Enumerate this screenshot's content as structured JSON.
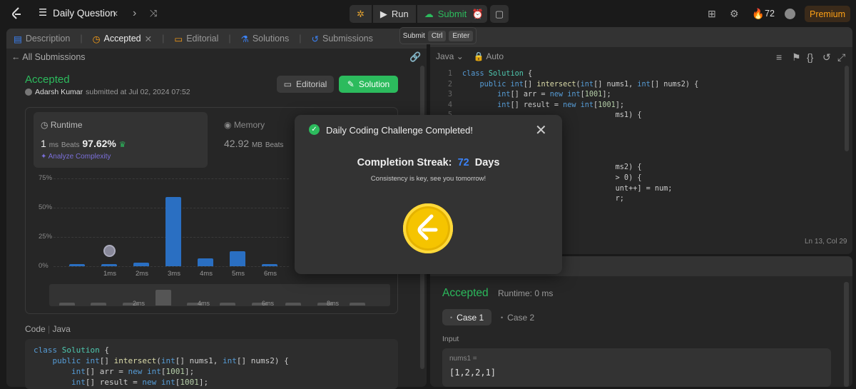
{
  "topbar": {
    "title": "Daily Question",
    "run_label": "Run",
    "submit_label": "Submit",
    "streak_count": "72",
    "premium_label": "Premium"
  },
  "tooltip": {
    "label": "Submit",
    "key1": "Ctrl",
    "key2": "Enter"
  },
  "tabs": [
    {
      "label": "Description"
    },
    {
      "label": "Accepted"
    },
    {
      "label": "Editorial"
    },
    {
      "label": "Solutions"
    },
    {
      "label": "Submissions"
    }
  ],
  "submission": {
    "back_label": "All Submissions",
    "status": "Accepted",
    "author": "Adarsh Kumar",
    "submitted_text": "submitted at Jul 02, 2024 07:52",
    "editorial_label": "Editorial",
    "solution_label": "Solution"
  },
  "runtime": {
    "title": "Runtime",
    "value": "1",
    "unit": "ms",
    "beats_label": "Beats",
    "beats": "97.62%",
    "analyze_label": "Analyze Complexity"
  },
  "memory": {
    "title": "Memory",
    "value": "42.92",
    "unit": "MB",
    "beats_label": "Beats"
  },
  "chart_data": {
    "type": "bar",
    "categories": [
      "0ms",
      "1ms",
      "2ms",
      "3ms",
      "4ms",
      "5ms",
      "6ms"
    ],
    "values": [
      2,
      2,
      3,
      59,
      7,
      13,
      2
    ],
    "ylim": [
      0,
      75
    ],
    "yticks": [
      "75%",
      "50%",
      "25%",
      "0%"
    ],
    "xticks": [
      "1ms",
      "2ms",
      "3ms",
      "4ms",
      "5ms",
      "6ms"
    ],
    "range_labels": [
      "2ms",
      "4ms",
      "6ms",
      "8ms"
    ]
  },
  "code_section": {
    "label": "Code",
    "lang": "Java"
  },
  "editor": {
    "lang": "Java",
    "auto": "Auto",
    "cursor": "Ln 13, Col 29"
  },
  "results": {
    "status": "Accepted",
    "runtime": "Runtime: 0 ms",
    "case1": "Case 1",
    "case2": "Case 2",
    "input_label": "Input",
    "param": "nums1 =",
    "value": "[1,2,2,1]"
  },
  "modal": {
    "title": "Daily Coding Challenge Completed!",
    "streak_label": "Completion Streak:",
    "streak_num": "72",
    "streak_unit": "Days",
    "subtitle": "Consistency is key, see you tomorrow!"
  }
}
